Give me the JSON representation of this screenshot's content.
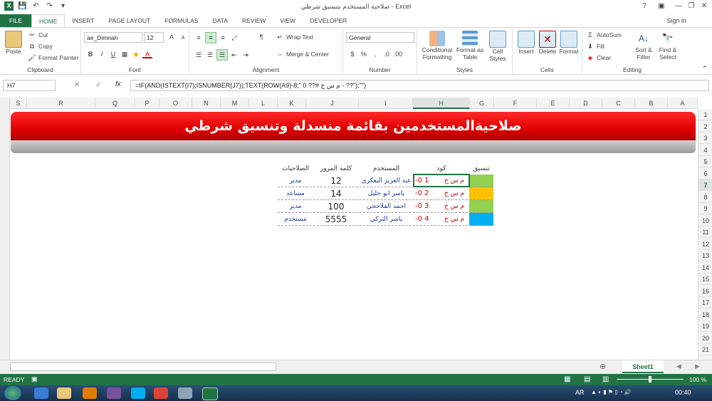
{
  "window": {
    "title": "صلاحية المستخدم بتنسيق شرطي - Excel",
    "help": "?",
    "minimize": "—",
    "restore": "❐",
    "close": "✕"
  },
  "tabs": [
    "FILE",
    "HOME",
    "INSERT",
    "PAGE LAYOUT",
    "FORMULAS",
    "DATA",
    "REVIEW",
    "VIEW",
    "DEVELOPER"
  ],
  "active_tab": "HOME",
  "signin": "Sign in",
  "ribbon": {
    "clipboard": {
      "label": "Clipboard",
      "paste": "Paste",
      "cut": "Cut",
      "copy": "Copy",
      "format_painter": "Format Painter"
    },
    "font": {
      "label": "Font",
      "name": "ae_Dimnah",
      "size": "12"
    },
    "alignment": {
      "label": "Alignment",
      "wrap": "Wrap Text",
      "merge": "Merge & Center"
    },
    "number": {
      "label": "Number",
      "format": "General"
    },
    "styles": {
      "label": "Styles",
      "conditional": "Conditional Formatting",
      "format_table": "Format as Table",
      "cell_styles": "Cell Styles"
    },
    "cells": {
      "label": "Cells",
      "insert": "Insert",
      "delete": "Delete",
      "format": "Format"
    },
    "editing": {
      "label": "Editing",
      "autosum": "AutoSum",
      "fill": "Fill",
      "clear": "Clear",
      "sort": "Sort & Filter",
      "find": "Find & Select"
    }
  },
  "formula_bar": {
    "name_box": "H7",
    "formula": "=IF(AND(ISTEXT(I7);ISNUMBER(J7));TEXT(ROW(A9)-8;\" 0 ??# م س خ - ??\");\"\")"
  },
  "columns": [
    "S",
    "R",
    "Q",
    "P",
    "O",
    "N",
    "M",
    "L",
    "K",
    "J",
    "I",
    "H",
    "G",
    "F",
    "E",
    "D",
    "C",
    "B",
    "A"
  ],
  "active_column": "H",
  "rows": [
    "1",
    "2",
    "3",
    "4",
    "5",
    "6",
    "7",
    "8",
    "9",
    "10",
    "11",
    "12",
    "13",
    "14",
    "15",
    "16",
    "17",
    "18",
    "19",
    "20",
    "21"
  ],
  "active_row": "7",
  "banner_title": "صلاحيةالمستخدمين بقائمة منسدلة وتنسيق شرطي",
  "table": {
    "headers": {
      "fmt": "تنسيق",
      "code": "كود",
      "user": "المستخدم",
      "password": "كلمة المرور",
      "perm": "الصلاحيات"
    },
    "rows": [
      {
        "fmt_text": "م س خ",
        "code": "-0   1",
        "user": "عبد العزيز البعكري",
        "password": "12",
        "perm": "مدير",
        "color": "#92d050"
      },
      {
        "fmt_text": "م س خ",
        "code": "-0   2",
        "user": "ياسر ابو خليل",
        "password": "14",
        "perm": "مساعد",
        "color": "#ffc000"
      },
      {
        "fmt_text": "م س خ",
        "code": "-0   3",
        "user": "احمد الفلاحجي",
        "password": "100",
        "perm": "مدير",
        "color": "#92d050"
      },
      {
        "fmt_text": "م س خ",
        "code": "-0   4",
        "user": "ياسر التركي",
        "password": "5555",
        "perm": "مستخدم",
        "color": "#00b0f0"
      }
    ]
  },
  "sheet_tab": "Sheet1",
  "status": {
    "ready": "READY",
    "zoom": "100 %"
  },
  "taskbar": {
    "lang": "AR",
    "time": "00:40"
  }
}
